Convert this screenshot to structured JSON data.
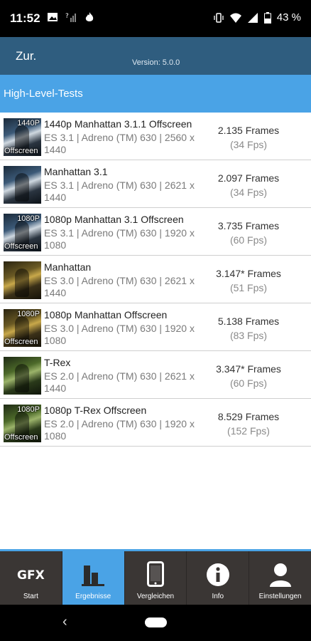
{
  "status": {
    "time": "11:52",
    "battery": "43 %",
    "left_icons": [
      "image-icon",
      "no-signal-icon",
      "flame-icon"
    ],
    "right_icons": [
      "vibrate-icon",
      "wifi-icon",
      "signal-icon",
      "battery-icon"
    ]
  },
  "appbar": {
    "back_label": "Zur.",
    "version": "Version: 5.0.0"
  },
  "section": {
    "title": "High-Level-Tests"
  },
  "tests": [
    {
      "name": "1440p Manhattan 3.1.1 Offscreen",
      "api": "ES 3.1 | Adreno (TM) 630 | 2560 x 1440",
      "frames": "2.135 Frames",
      "fps": "(34 Fps)",
      "tag_top": "1440P",
      "tag_bottom": "Offscreen",
      "thumb": "manhattan"
    },
    {
      "name": "Manhattan 3.1",
      "api": "ES 3.1 | Adreno (TM) 630 | 2621 x 1440",
      "frames": "2.097 Frames",
      "fps": "(34 Fps)",
      "tag_top": "",
      "tag_bottom": "",
      "thumb": "manhattan"
    },
    {
      "name": "1080p Manhattan 3.1 Offscreen",
      "api": "ES 3.1 | Adreno (TM) 630 | 1920 x 1080",
      "frames": "3.735 Frames",
      "fps": "(60 Fps)",
      "tag_top": "1080P",
      "tag_bottom": "Offscreen",
      "thumb": "manhattan"
    },
    {
      "name": "Manhattan",
      "api": "ES 3.0 | Adreno (TM) 630 | 2621 x 1440",
      "frames": "3.147* Frames",
      "fps": "(51 Fps)",
      "tag_top": "",
      "tag_bottom": "",
      "thumb": "manhattan-gold"
    },
    {
      "name": "1080p Manhattan Offscreen",
      "api": "ES 3.0 | Adreno (TM) 630 | 1920 x 1080",
      "frames": "5.138 Frames",
      "fps": "(83 Fps)",
      "tag_top": "1080P",
      "tag_bottom": "Offscreen",
      "thumb": "manhattan-gold"
    },
    {
      "name": "T-Rex",
      "api": "ES 2.0 | Adreno (TM) 630 | 2621 x 1440",
      "frames": "3.347* Frames",
      "fps": "(60 Fps)",
      "tag_top": "",
      "tag_bottom": "",
      "thumb": "trex"
    },
    {
      "name": "1080p T-Rex Offscreen",
      "api": "ES 2.0 | Adreno (TM) 630 | 1920 x 1080",
      "frames": "8.529 Frames",
      "fps": "(152 Fps)",
      "tag_top": "1080P",
      "tag_bottom": "Offscreen",
      "thumb": "trex"
    }
  ],
  "tabs": [
    {
      "label": "Start",
      "icon": "gfx-logo-icon",
      "icon_text": "GFX"
    },
    {
      "label": "Ergebnisse",
      "icon": "bar-chart-icon",
      "active": true
    },
    {
      "label": "Vergleichen",
      "icon": "phone-icon"
    },
    {
      "label": "Info",
      "icon": "info-icon"
    },
    {
      "label": "Einstellungen",
      "icon": "user-icon"
    }
  ],
  "colors": {
    "appbar": "#2f5d7f",
    "accent": "#4aa3e6",
    "tabbar": "#3a3634"
  }
}
